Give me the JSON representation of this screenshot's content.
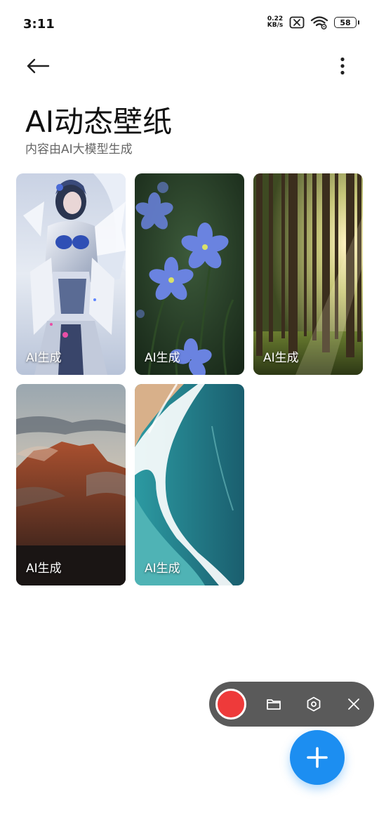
{
  "status_bar": {
    "time": "3:11",
    "net_speed_value": "0.22",
    "net_speed_unit": "KB/s",
    "battery": "58"
  },
  "header": {
    "title": "AI动态壁纸",
    "subtitle": "内容由AI大模型生成"
  },
  "wallpapers": [
    {
      "label": "AI生成",
      "subject": "mecha-angel"
    },
    {
      "label": "AI生成",
      "subject": "blue-flowers"
    },
    {
      "label": "AI生成",
      "subject": "sunlit-forest"
    },
    {
      "label": "AI生成",
      "subject": "mountain-clouds"
    },
    {
      "label": "AI生成",
      "subject": "ocean-waves"
    }
  ],
  "icons": {
    "back": "arrow-left-icon",
    "more": "more-vertical-icon",
    "record": "record-icon",
    "folder": "folder-icon",
    "settings": "hexagon-settings-icon",
    "close": "close-icon",
    "add": "plus-icon"
  },
  "colors": {
    "accent": "#1c8ef1",
    "record": "#ee3a3a",
    "recorder_bg": "#5a5a5a"
  }
}
